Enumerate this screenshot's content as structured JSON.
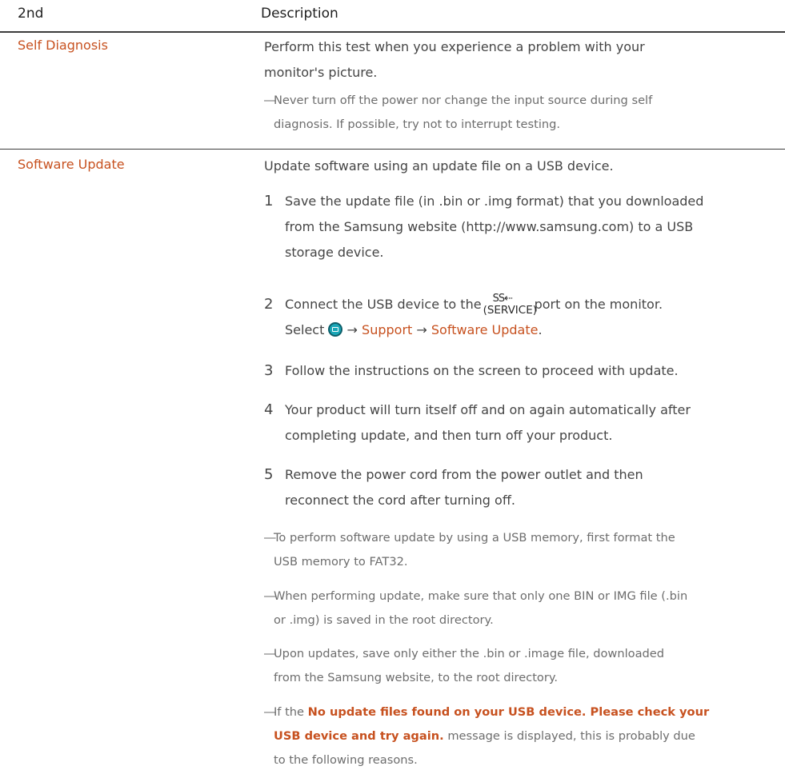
{
  "header": {
    "col1": "2nd",
    "col2": "Description"
  },
  "self_diagnosis": {
    "name": "Self Diagnosis",
    "desc_line1": "Perform this test when you experience a problem with your",
    "desc_line2": "monitor's picture.",
    "note_line1": "Never turn off the power nor change the input source during self",
    "note_line2": "diagnosis. If possible, try not to interrupt testing."
  },
  "software_update": {
    "name": "Software Update",
    "intro": "Update software using an update file on a USB device.",
    "steps": [
      {
        "num": "1",
        "line1": "Save the update file (in .bin or .img format) that you downloaded",
        "line2": "from the Samsung website (http://www.samsung.com) to a USB",
        "line3": "storage device."
      },
      {
        "num": "2",
        "line1_pre": "Connect the USB device to the",
        "port_logo": "SS⇠",
        "port_label": "(SERVICE)",
        "line1_post": "port on the monitor.",
        "line2_pre": "Select",
        "icon": "menu-icon",
        "arrow1": "→",
        "path1": "Support",
        "arrow2": "→",
        "path2": "Software Update",
        "end": "."
      },
      {
        "num": "3",
        "line1": "Follow the instructions on the screen to proceed with update."
      },
      {
        "num": "4",
        "line1": "Your product will turn itself off and on again automatically after",
        "line2": "completing update, and then turn off your product."
      },
      {
        "num": "5",
        "line1": "Remove the power cord from the power outlet and then",
        "line2": "reconnect the cord after turning off."
      }
    ],
    "notes": [
      {
        "line1": "To perform software update by using a USB memory, first format the",
        "line2": "USB memory to FAT32."
      },
      {
        "line1": "When performing update, make sure that only one BIN or IMG file (.bin",
        "line2": "or .img) is saved in the root directory."
      },
      {
        "line1": "Upon updates, save only either the .bin or .image file, downloaded",
        "line2": "from the Samsung website, to the root directory."
      },
      {
        "line1_pre": "If the",
        "msg_part1": "No update files found on your USB device. Please check your",
        "msg_part2": "USB device and try again.",
        "line2_post": "message is displayed, this is probably due",
        "line3": "to the following reasons."
      }
    ]
  },
  "colors": {
    "accent": "#c7511f",
    "body": "#454545",
    "note": "#6d6d6d",
    "rule": "#3c3c3c"
  }
}
